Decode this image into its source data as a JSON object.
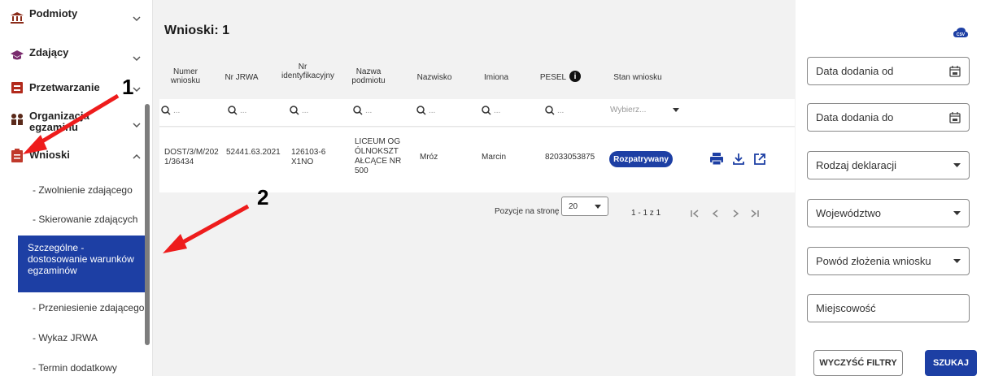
{
  "sidebar": {
    "items": [
      {
        "label": "Podmioty",
        "icon": "bank-icon"
      },
      {
        "label": "Zdający",
        "icon": "graduation-cap-icon"
      },
      {
        "label": "Przetwarzanie",
        "icon": "box-icon"
      },
      {
        "label": "Organizacja egzaminu",
        "icon": "people-icon"
      },
      {
        "label": "Wnioski",
        "icon": "clipboard-icon"
      }
    ],
    "subitems": [
      "- Zwolnienie zdającego",
      "- Skierowanie zdających",
      "Szczególne - dostosowanie warunków egzaminów",
      "- Przeniesienie zdającego",
      "- Wykaz JRWA",
      "- Termin dodatkowy"
    ]
  },
  "main": {
    "title": "Wnioski: 1",
    "columns": [
      "Numer wniosku",
      "Nr JRWA",
      "Nr identyfikacyjny",
      "Nazwa podmiotu",
      "Nazwisko",
      "Imiona",
      "PESEL",
      "Stan wniosku"
    ],
    "filters": {
      "search_placeholder": "...",
      "status_placeholder": "Wybierz..."
    },
    "row": {
      "numer": "DOST/3/M/2021/36434",
      "jrwa": "52441.63.2021",
      "ident": "126103-6X1NO",
      "podmiot": "LICEUM OGÓLNOKSZTAŁCĄCE NR 500",
      "nazwisko": "Mróz",
      "imiona": "Marcin",
      "pesel": "82033053875",
      "stan": "Rozpatrywany"
    },
    "pager": {
      "label": "Pozycje na stronę",
      "per_page": "20",
      "range": "1 - 1 z 1"
    }
  },
  "right": {
    "fields": [
      "Data dodania od",
      "Data dodania do",
      "Rodzaj deklaracji",
      "Województwo",
      "Powód złożenia wniosku",
      "Miejscowość"
    ],
    "clear_label": "WYCZYŚĆ FILTRY",
    "search_label": "SZUKAJ"
  },
  "annotations": [
    "1",
    "2"
  ],
  "colors": {
    "primary": "#1d3fa4",
    "arrow": "#ee1c1c",
    "accent_icon": "#c0392b"
  }
}
